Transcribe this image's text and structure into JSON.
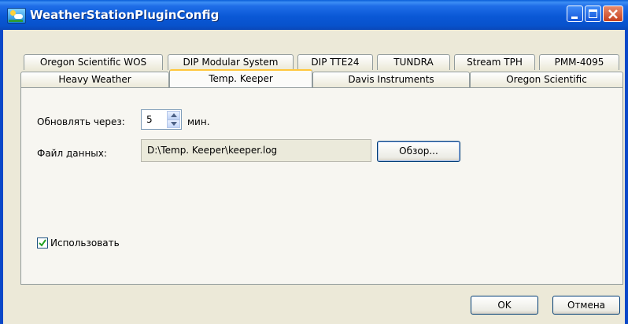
{
  "window": {
    "title": "WeatherStationPluginConfig",
    "app_icon": "weather-station-icon",
    "controls": [
      "minimize-icon",
      "maximize-icon",
      "close-icon"
    ]
  },
  "tabs": {
    "row1": [
      "Oregon Scientific WOS",
      "DIP Modular System",
      "DIP TTE24",
      "TUNDRA",
      "Stream TPH",
      "PMM-4095"
    ],
    "row2": [
      "Heavy Weather",
      "Temp. Keeper",
      "Davis Instruments",
      "Oregon Scientific"
    ],
    "active": "Temp. Keeper"
  },
  "panel": {
    "update_label": "Обновлять через:",
    "update_value": "5",
    "update_unit": "мин.",
    "file_label": "Файл данных:",
    "file_value": "D:\\Temp. Keeper\\keeper.log",
    "browse_label": "Обзор...",
    "use_label": "Использовать",
    "use_checked": true
  },
  "footer": {
    "ok_label": "OK",
    "cancel_label": "Отмена"
  },
  "colors": {
    "titlebar": "#0a58d6",
    "active_tab_accent": "#ffc73c",
    "face": "#ece9d8"
  }
}
